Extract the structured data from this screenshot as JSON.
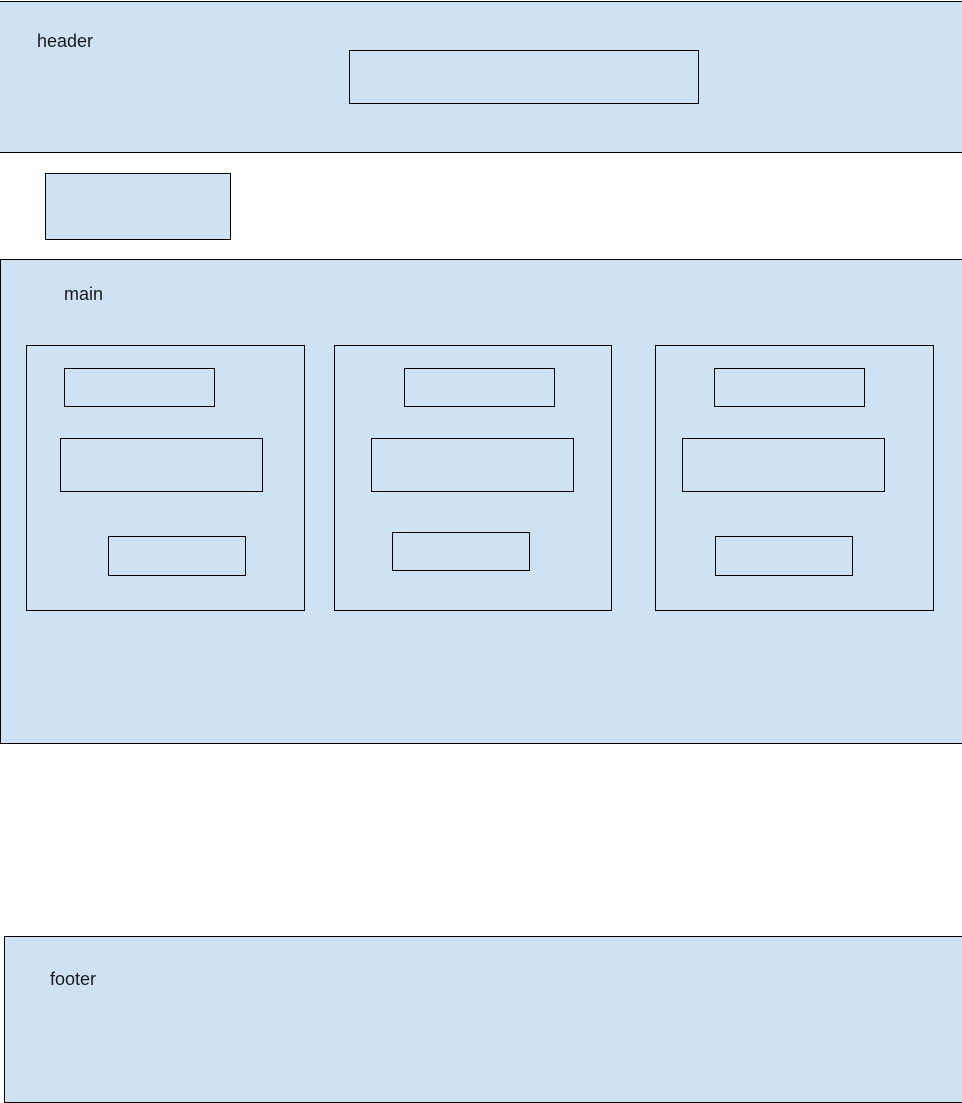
{
  "colors": {
    "fill": "#cfe2f3",
    "stroke": "#000000",
    "background": "#ffffff"
  },
  "header": {
    "label": "header"
  },
  "main": {
    "label": "main"
  },
  "footer": {
    "label": "footer"
  }
}
